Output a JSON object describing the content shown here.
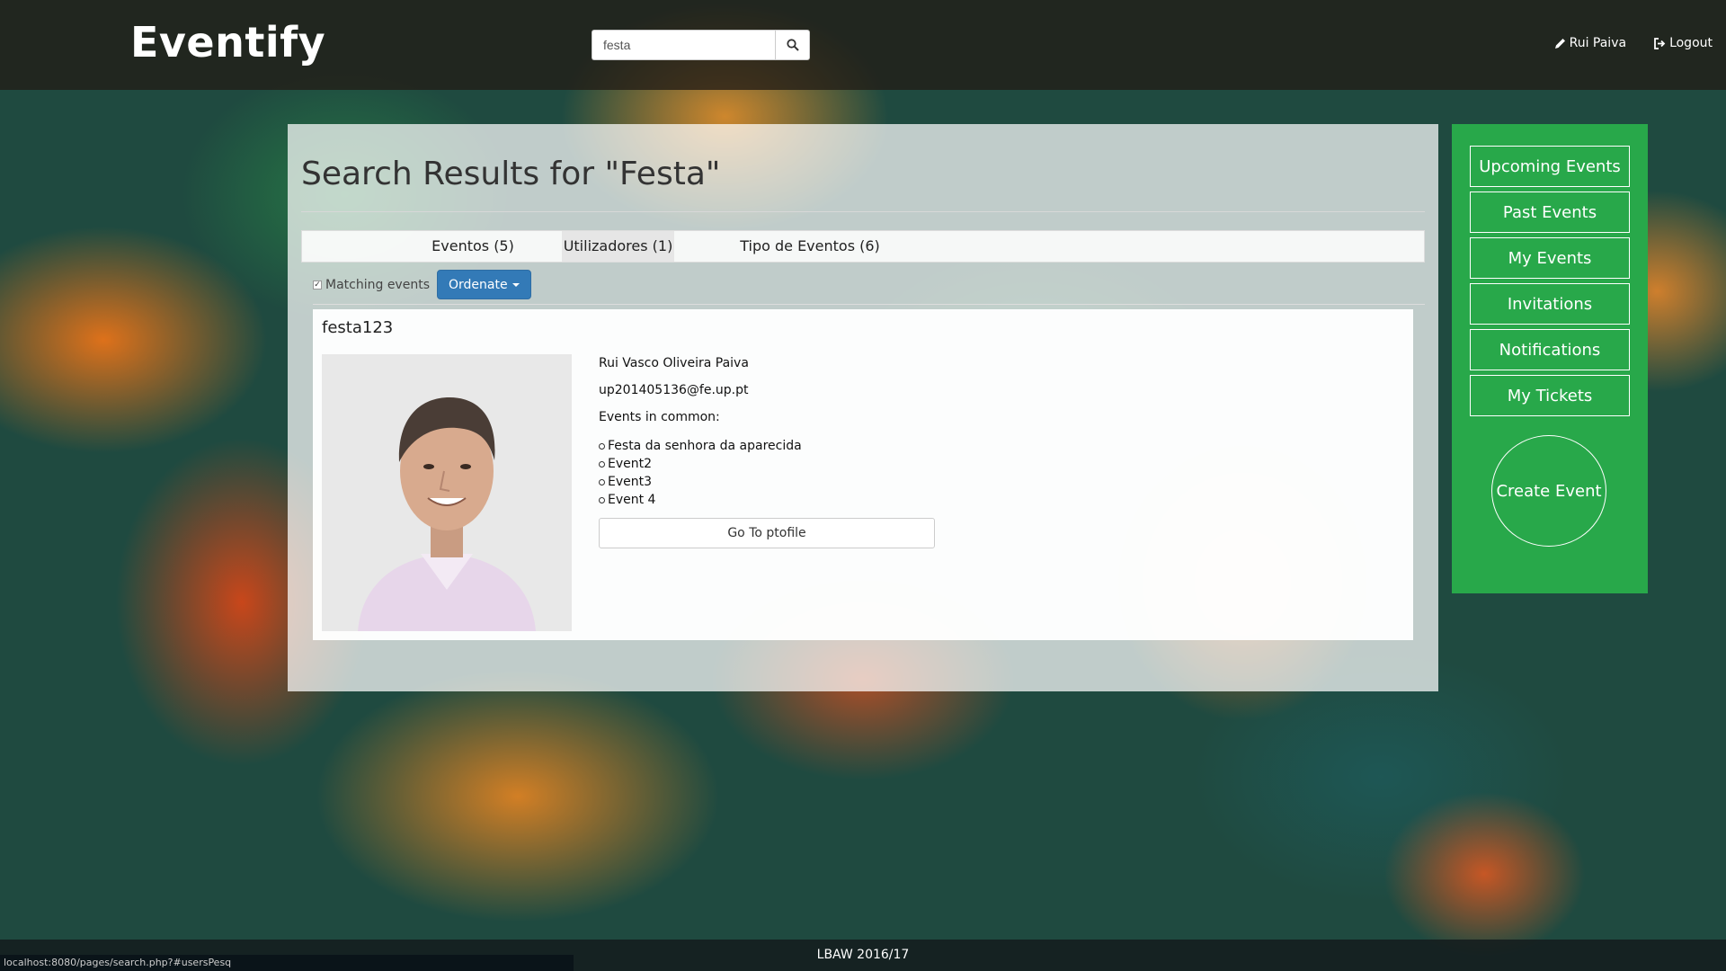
{
  "app": {
    "brand": "Eventify"
  },
  "header": {
    "search_value": "festa",
    "search_icon": "search-icon",
    "user_link": "Rui Paiva",
    "user_icon": "pencil-icon",
    "logout_link": "Logout",
    "logout_icon": "logout-icon"
  },
  "main": {
    "title": "Search Results for \"Festa\"",
    "tabs": [
      {
        "label": "Eventos (5)"
      },
      {
        "label": "Utilizadores (1)",
        "active": true
      },
      {
        "label": "Tipo de Eventos (6)"
      }
    ],
    "filter": {
      "checkbox_checked": true,
      "checkbox_label": "Matching events",
      "ordenate_label": "Ordenate"
    },
    "result": {
      "username": "festa123",
      "full_name": "Rui Vasco Oliveira Paiva",
      "email": "up201405136@fe.up.pt",
      "events_heading": "Events in common:",
      "events": [
        "Festa da senhora da aparecida",
        "Event2",
        "Event3",
        "Event 4"
      ],
      "profile_button": "Go To ptofile"
    }
  },
  "sidebar": {
    "items": [
      {
        "label": "Upcoming Events"
      },
      {
        "label": "Past Events"
      },
      {
        "label": "My Events"
      },
      {
        "label": "Invitations"
      },
      {
        "label": "Notifications"
      },
      {
        "label": "My Tickets"
      }
    ],
    "create_label": "Create Event",
    "accent_color": "#28a84a"
  },
  "footer": {
    "text": "LBAW 2016/17"
  },
  "statusbar": {
    "url": "localhost:8080/pages/search.php?#usersPesq"
  }
}
